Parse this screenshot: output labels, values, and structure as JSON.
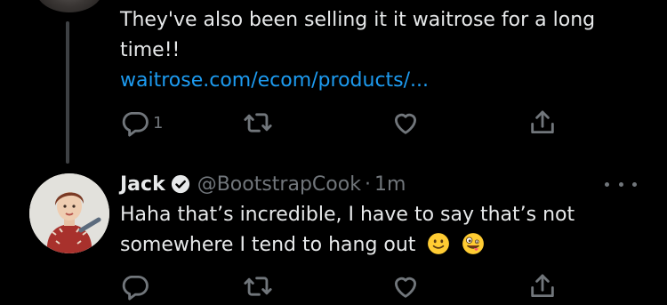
{
  "thread": {
    "prev_tweet": {
      "text_line": "They've also been selling it it waitrose for a long time!!",
      "link": "waitrose.com/ecom/products/...",
      "reply_count": "1"
    },
    "reply_tweet": {
      "name": "Jack",
      "handle": "@BootstrapCook",
      "separator": "·",
      "time": "1m",
      "text": "Haha that’s incredible, I have to say that’s not somewhere I tend to hang out",
      "emojis": [
        "slightly-smiling-face",
        "zany-face"
      ]
    }
  },
  "colors": {
    "background": "#000000",
    "text": "#e7e9ea",
    "secondary": "#71767b",
    "link": "#1d9bf0",
    "thread_line": "#3e4144"
  }
}
